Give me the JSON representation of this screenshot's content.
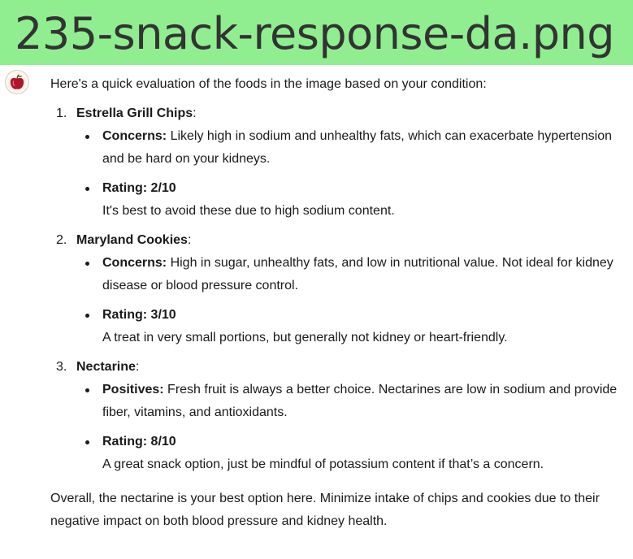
{
  "banner": {
    "title": "235-snack-response-da.png"
  },
  "message": {
    "intro": "Here's a quick evaluation of the foods in the image based on your condition:",
    "foods": [
      {
        "number": "1.",
        "name": "Estrella Grill Chips",
        "points": [
          {
            "label": "Concerns:",
            "text": " Likely high in sodium and unhealthy fats, which can exacerbate hypertension and be hard on your kidneys."
          },
          {
            "label": "Rating: 2/10",
            "text": "It's best to avoid these due to high sodium content."
          }
        ]
      },
      {
        "number": "2.",
        "name": "Maryland Cookies",
        "points": [
          {
            "label": "Concerns:",
            "text": " High in sugar, unhealthy fats, and low in nutritional value. Not ideal for kidney disease or blood pressure control."
          },
          {
            "label": "Rating: 3/10",
            "text": "A treat in very small portions, but generally not kidney or heart-friendly."
          }
        ]
      },
      {
        "number": "3.",
        "name": "Nectarine",
        "points": [
          {
            "label": "Positives:",
            "text": " Fresh fruit is always a better choice. Nectarines are low in sodium and provide fiber, vitamins, and antioxidants."
          },
          {
            "label": "Rating: 8/10",
            "text": "A great snack option, just be mindful of potassium content if that’s a concern."
          }
        ]
      }
    ],
    "summary": "Overall, the nectarine is your best option here. Minimize intake of chips and cookies due to their negative impact on both blood pressure and kidney health."
  },
  "icons": {
    "avatar": "apple-icon"
  },
  "colors": {
    "banner": "#90ee90",
    "text": "#1a1a1a",
    "apple": "#b0152a"
  }
}
